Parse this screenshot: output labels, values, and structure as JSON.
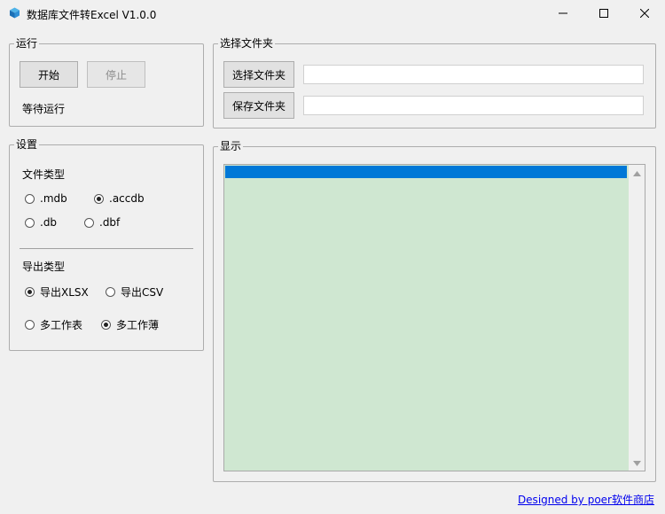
{
  "window": {
    "title": "数据库文件转Excel V1.0.0",
    "controls": {
      "minimize": "minimize",
      "maximize": "maximize",
      "close": "close"
    }
  },
  "run_group": {
    "legend": "运行",
    "start_label": "开始",
    "stop_label": "停止",
    "status_text": "等待运行"
  },
  "folder_group": {
    "legend": "选择文件夹",
    "select_folder_label": "选择文件夹",
    "save_folder_label": "保存文件夹",
    "select_folder_value": "",
    "save_folder_value": ""
  },
  "settings_group": {
    "legend": "设置",
    "file_type_label": "文件类型",
    "file_types": [
      {
        "label": ".mdb",
        "checked": false
      },
      {
        "label": ".accdb",
        "checked": true
      },
      {
        "label": ".db",
        "checked": false
      },
      {
        "label": ".dbf",
        "checked": false
      }
    ],
    "export_type_label": "导出类型",
    "export_formats": [
      {
        "label": "导出XLSX",
        "checked": true
      },
      {
        "label": "导出CSV",
        "checked": false
      }
    ],
    "sheet_modes": [
      {
        "label": "多工作表",
        "checked": false
      },
      {
        "label": "多工作薄",
        "checked": true
      }
    ]
  },
  "display_group": {
    "legend": "显示",
    "items": [
      ""
    ]
  },
  "footer": {
    "link_text": "Designed by poer软件商店"
  },
  "colors": {
    "listbox_bg": "#cfe7d1",
    "selection": "#0078d7",
    "link": "#0000ee"
  }
}
